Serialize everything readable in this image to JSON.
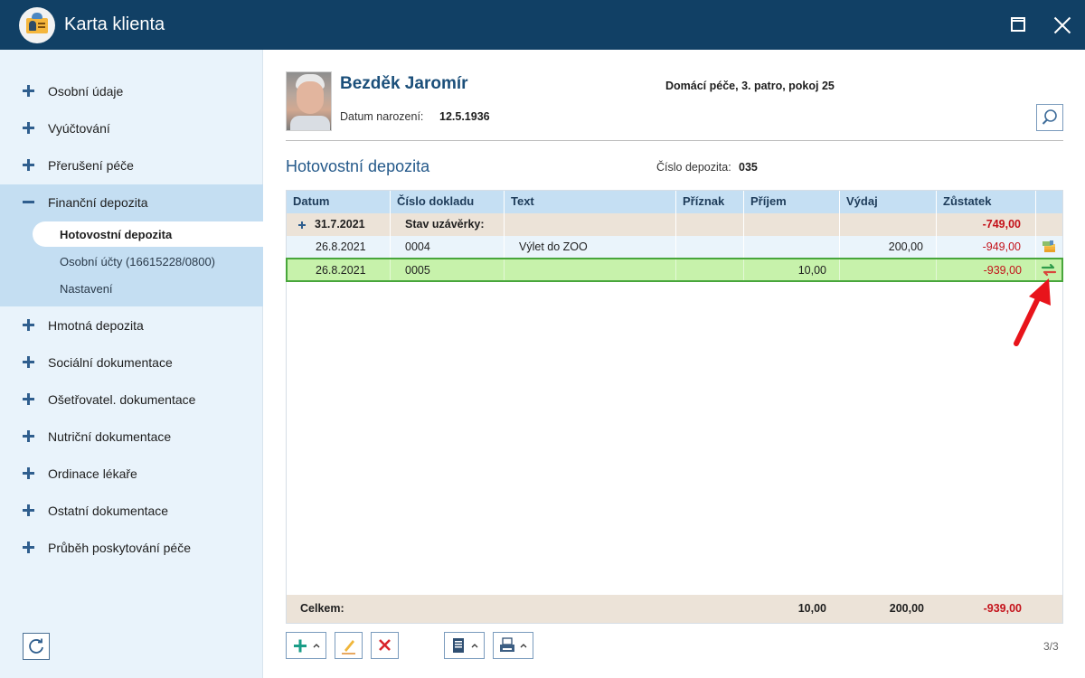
{
  "window": {
    "title": "Karta klienta",
    "icon": "client-card-icon"
  },
  "sidebar": {
    "items": [
      {
        "label": "Osobní údaje",
        "icon": "plus-icon"
      },
      {
        "label": "Vyúčtování",
        "icon": "plus-icon"
      },
      {
        "label": "Přerušení péče",
        "icon": "plus-icon"
      },
      {
        "label": "Finanční depozita",
        "icon": "minus-icon",
        "expanded": true
      },
      {
        "label": "Hmotná depozita",
        "icon": "plus-icon"
      },
      {
        "label": "Sociální dokumentace",
        "icon": "plus-icon"
      },
      {
        "label": "Ošetřovatel. dokumentace",
        "icon": "plus-icon"
      },
      {
        "label": "Nutriční dokumentace",
        "icon": "plus-icon"
      },
      {
        "label": "Ordinace lékaře",
        "icon": "plus-icon"
      },
      {
        "label": "Ostatní dokumentace",
        "icon": "plus-icon"
      },
      {
        "label": "Průběh poskytování péče",
        "icon": "plus-icon"
      }
    ],
    "subitems": [
      {
        "label": "Hotovostní depozita",
        "active": true
      },
      {
        "label": "Osobní účty (16615228/0800)",
        "active": false
      },
      {
        "label": "Nastavení",
        "active": false
      }
    ]
  },
  "client": {
    "name": "Bezděk Jaromír",
    "birth_label": "Datum narození:",
    "birth_date": "12.5.1936",
    "location": "Domácí péče, 3. patro, pokoj 25"
  },
  "section": {
    "title": "Hotovostní depozita",
    "deposit_number_label": "Číslo depozita:",
    "deposit_number": "035"
  },
  "table": {
    "columns": [
      "Datum",
      "Číslo dokladu",
      "Text",
      "Příznak",
      "Příjem",
      "Výdaj",
      "Zůstatek"
    ],
    "group": {
      "date": "31.7.2021",
      "label": "Stav uzávěrky:",
      "balance": "-749,00"
    },
    "rows": [
      {
        "date": "26.8.2021",
        "doc": "0004",
        "text": "Výlet do ZOO",
        "flag": "",
        "income": "",
        "expense": "200,00",
        "balance": "-949,00",
        "action_icon": "cash-icon"
      },
      {
        "date": "26.8.2021",
        "doc": "0005",
        "text": "",
        "flag": "",
        "income": "10,00",
        "expense": "",
        "balance": "-939,00",
        "action_icon": "transfer-icon"
      }
    ],
    "total": {
      "label": "Celkem:",
      "income": "10,00",
      "expense": "200,00",
      "balance": "-939,00"
    }
  },
  "toolbar": {
    "buttons": [
      "add-icon",
      "edit-icon",
      "delete-icon",
      "document-icon",
      "print-icon"
    ],
    "page": "3/3"
  },
  "colors": {
    "titlebar": "#114065",
    "accent": "#24598a",
    "negative": "#c4121a",
    "selected_row": "#c7f2ab",
    "arrow": "#e8141b"
  }
}
